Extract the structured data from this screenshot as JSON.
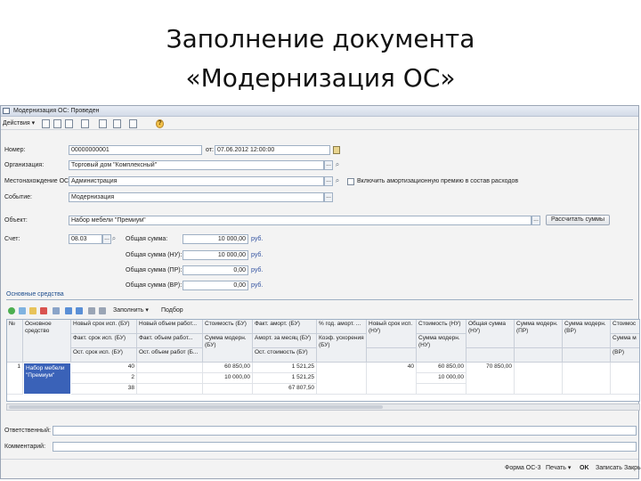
{
  "slide": {
    "title_line1": "Заполнение документа",
    "title_line2": "«Модернизация ОС»"
  },
  "window": {
    "title": "Модернизация ОС: Проведен"
  },
  "toolbar": {
    "actions_label": "Действия",
    "icons": [
      "save-icon",
      "post-icon",
      "copy-icon",
      "structure-icon",
      "print-icon",
      "list-icon",
      "report-icon",
      "help-icon"
    ],
    "help_glyph": "?"
  },
  "header": {
    "number_label": "Номер:",
    "number_value": "00000000001",
    "date_label": "от:",
    "date_value": "07.06.2012 12:00:00",
    "org_label": "Организация:",
    "org_value": "Торговый дом \"Комплексный\"",
    "location_label": "Местонахождение ОС:",
    "location_value": "Администрация",
    "include_bonus_label": "Включить амортизационную премию в состав расходов",
    "event_label": "Событие:",
    "event_value": "Модернизация",
    "object_label": "Объект:",
    "object_value": "Набор мебели \"Премиум\"",
    "calc_sums_button": "Рассчитать суммы",
    "account_label": "Счет:",
    "account_value": "08.03",
    "total_label": "Общая сумма:",
    "total_value": "10 000,00",
    "total_nu_label": "Общая сумма (НУ):",
    "total_nu_value": "10 000,00",
    "total_pr_label": "Общая сумма (ПР):",
    "total_pr_value": "0,00",
    "total_vr_label": "Общая сумма (ВР):",
    "total_vr_value": "0,00",
    "unit": "руб."
  },
  "grid_section": {
    "title": "Основные средства",
    "fill_label": "Заполнить",
    "pick_label": "Подбор",
    "columns": {
      "n": "№",
      "os": "Основное средство",
      "c1a": "Новый срок исп. (БУ)",
      "c1b": "Факт. срок исп. (БУ)",
      "c1c": "Ост. срок исп. (БУ)",
      "c2a": "Новый объем работ...",
      "c2b": "Факт. объем работ...",
      "c2c": "Ост. объем работ (Б...",
      "c3a": "Стоимость (БУ)",
      "c3b": "Сумма модерн. (БУ)",
      "c4a": "Факт. аморт. (БУ)",
      "c4b": "Аморт. за месяц (БУ)",
      "c4c": "Ост. стоимость (БУ)",
      "c5a": "% год. аморт. ...",
      "c5b": "Коэф. ускорения (БУ)",
      "c6a": "Новый срок исп. (НУ)",
      "c7a": "Стоимость (НУ)",
      "c7b": "Сумма модерн. (НУ)",
      "c8a": "Общая сумма (НУ)",
      "c9a": "Сумма модерн. (ПР)",
      "c10a": "Сумма модерн. (ВР)",
      "c11a": "Стоимос",
      "c11b": "Сумма м",
      "c11c": "(ВР)"
    },
    "row": {
      "n": "1",
      "os": "Набор мебели \"Премиум\"",
      "c1a": "40",
      "c1b": "2",
      "c1c": "38",
      "c3a": "60 850,00",
      "c3b": "10 000,00",
      "c4a": "1 521,25",
      "c4b": "1 521,25",
      "c4c": "67 807,50",
      "c6a": "40",
      "c7a": "60 850,00",
      "c7b": "10 000,00",
      "c8a": "70 850,00"
    }
  },
  "bottom": {
    "responsible_label": "Ответственный:",
    "comment_label": "Комментарий:",
    "print_form": "Форма ОС-3",
    "print": "Печать",
    "ok": "OK",
    "save": "Записать",
    "close": "Закрыть"
  }
}
